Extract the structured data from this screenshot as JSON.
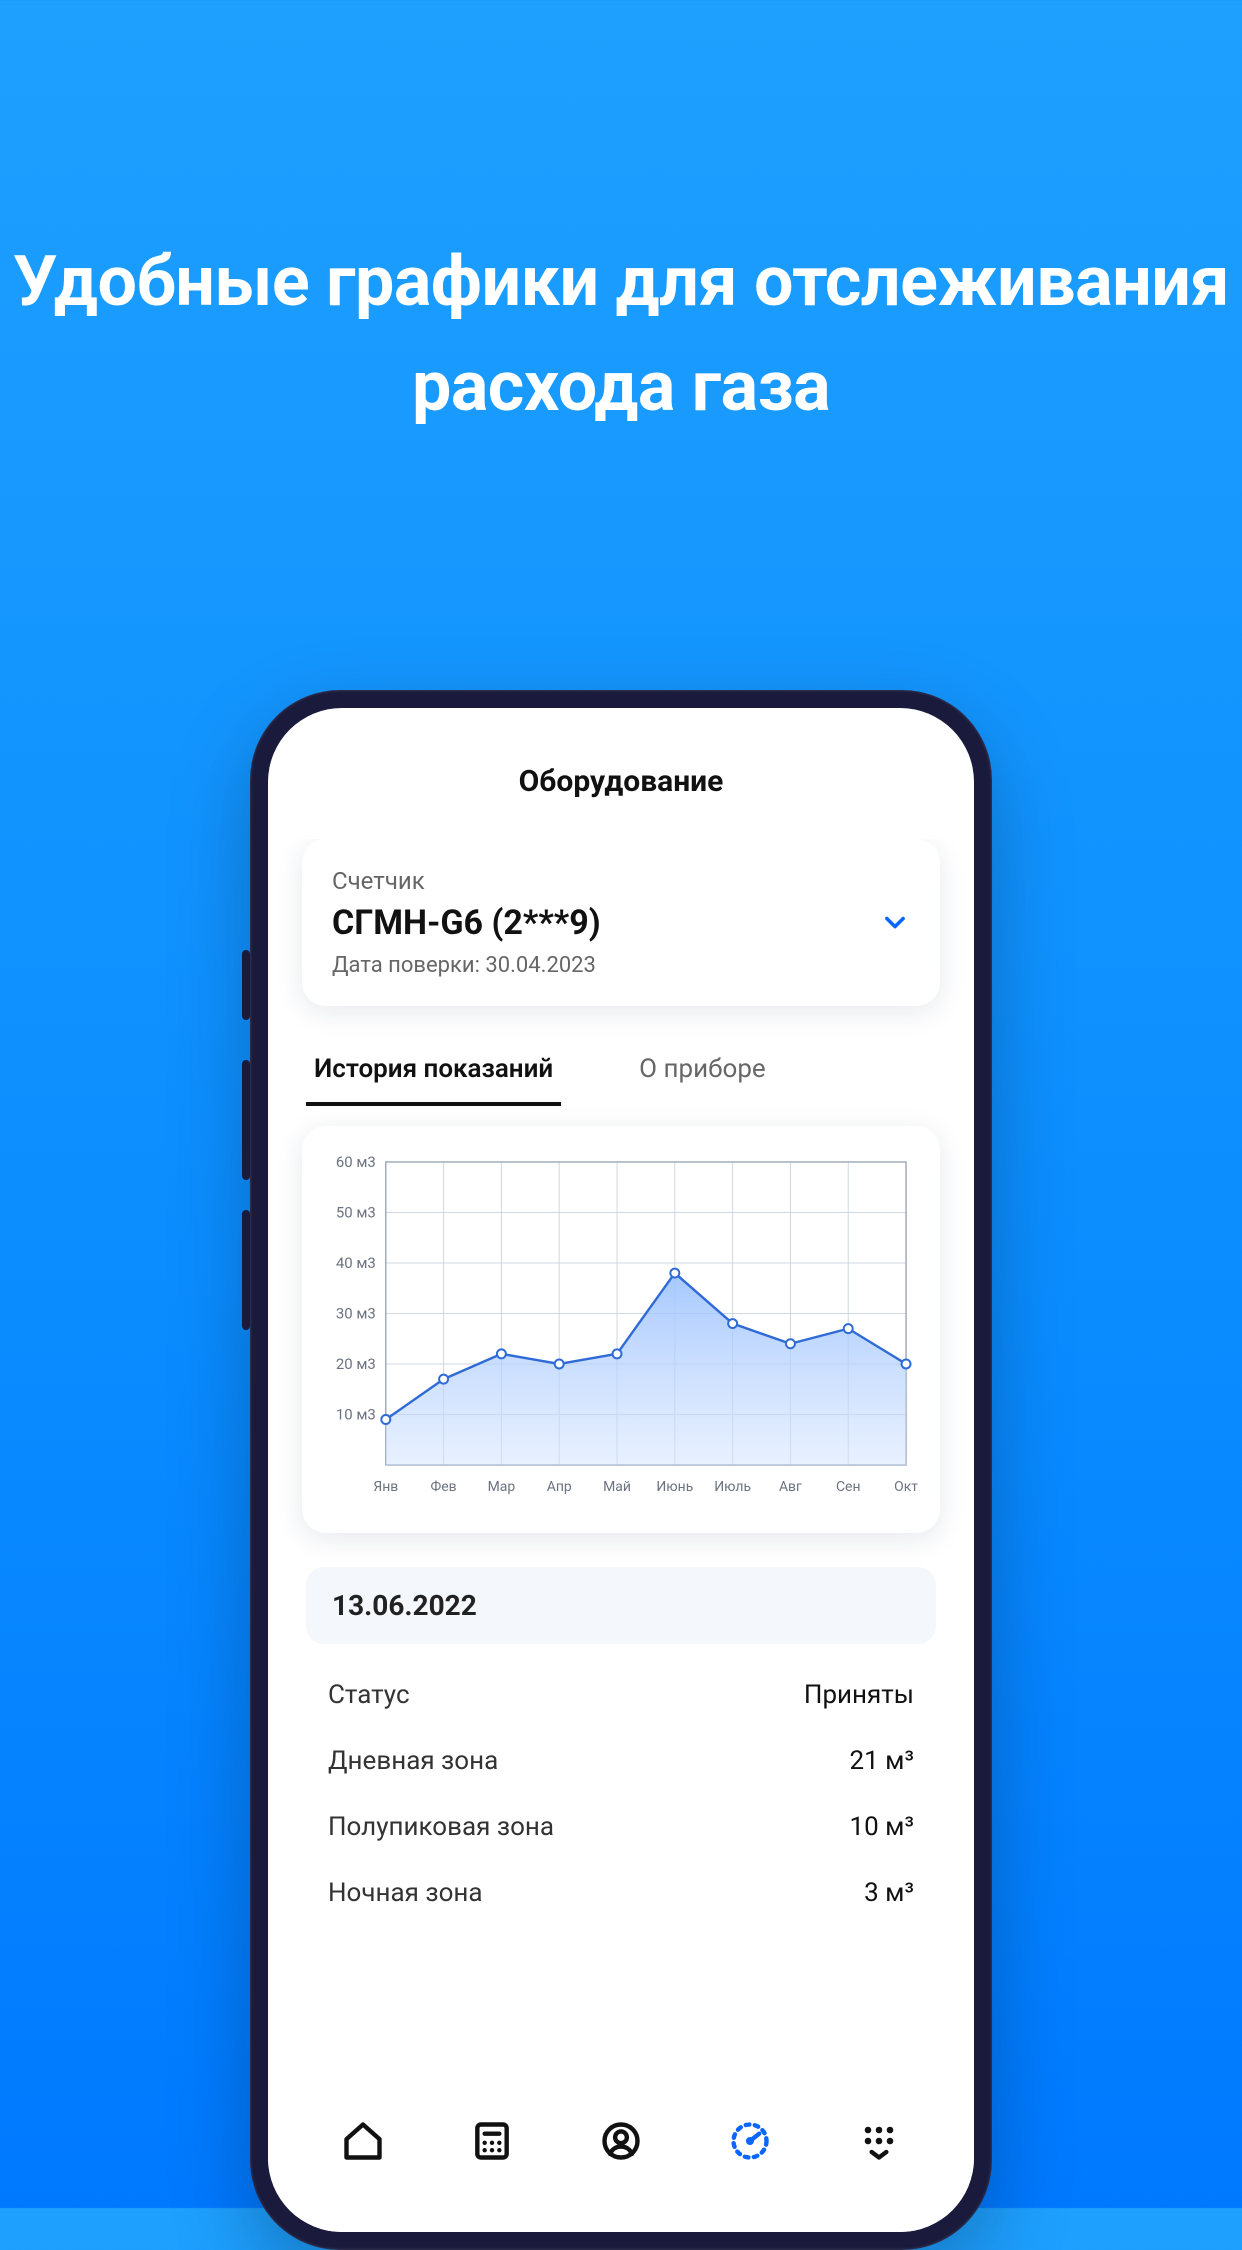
{
  "promo_title": "Удобные графики для отслеживания расхода газа",
  "header": {
    "title": "Оборудование"
  },
  "meter": {
    "label": "Счетчик",
    "name": "СГМН-G6 (2***9)",
    "verification_prefix": "Дата поверки: ",
    "verification_date": "30.04.2023"
  },
  "tabs": {
    "history": "История показаний",
    "about": "О приборе",
    "active": "history"
  },
  "chart_data": {
    "type": "area",
    "title": "",
    "xlabel": "",
    "ylabel": "",
    "ylim": [
      0,
      60
    ],
    "y_ticks": [
      "60 м3",
      "50 м3",
      "40 м3",
      "30 м3",
      "20 м3",
      "10 м3"
    ],
    "categories": [
      "Янв",
      "Фев",
      "Мар",
      "Апр",
      "Май",
      "Июнь",
      "Июль",
      "Авг",
      "Сен",
      "Окт"
    ],
    "values": [
      9,
      17,
      22,
      20,
      22,
      38,
      28,
      24,
      27,
      20
    ]
  },
  "last_reading": {
    "date": "13.06.2022",
    "rows": [
      {
        "label": "Статус",
        "value": "Приняты"
      },
      {
        "label": "Дневная зона",
        "value": "21 м³"
      },
      {
        "label": "Полупиковая зона",
        "value": "10 м³"
      },
      {
        "label": "Ночная зона",
        "value": "3 м³"
      }
    ]
  },
  "nav": {
    "items": [
      "home",
      "calculator",
      "profile",
      "meter",
      "more"
    ],
    "active_index": 3
  }
}
